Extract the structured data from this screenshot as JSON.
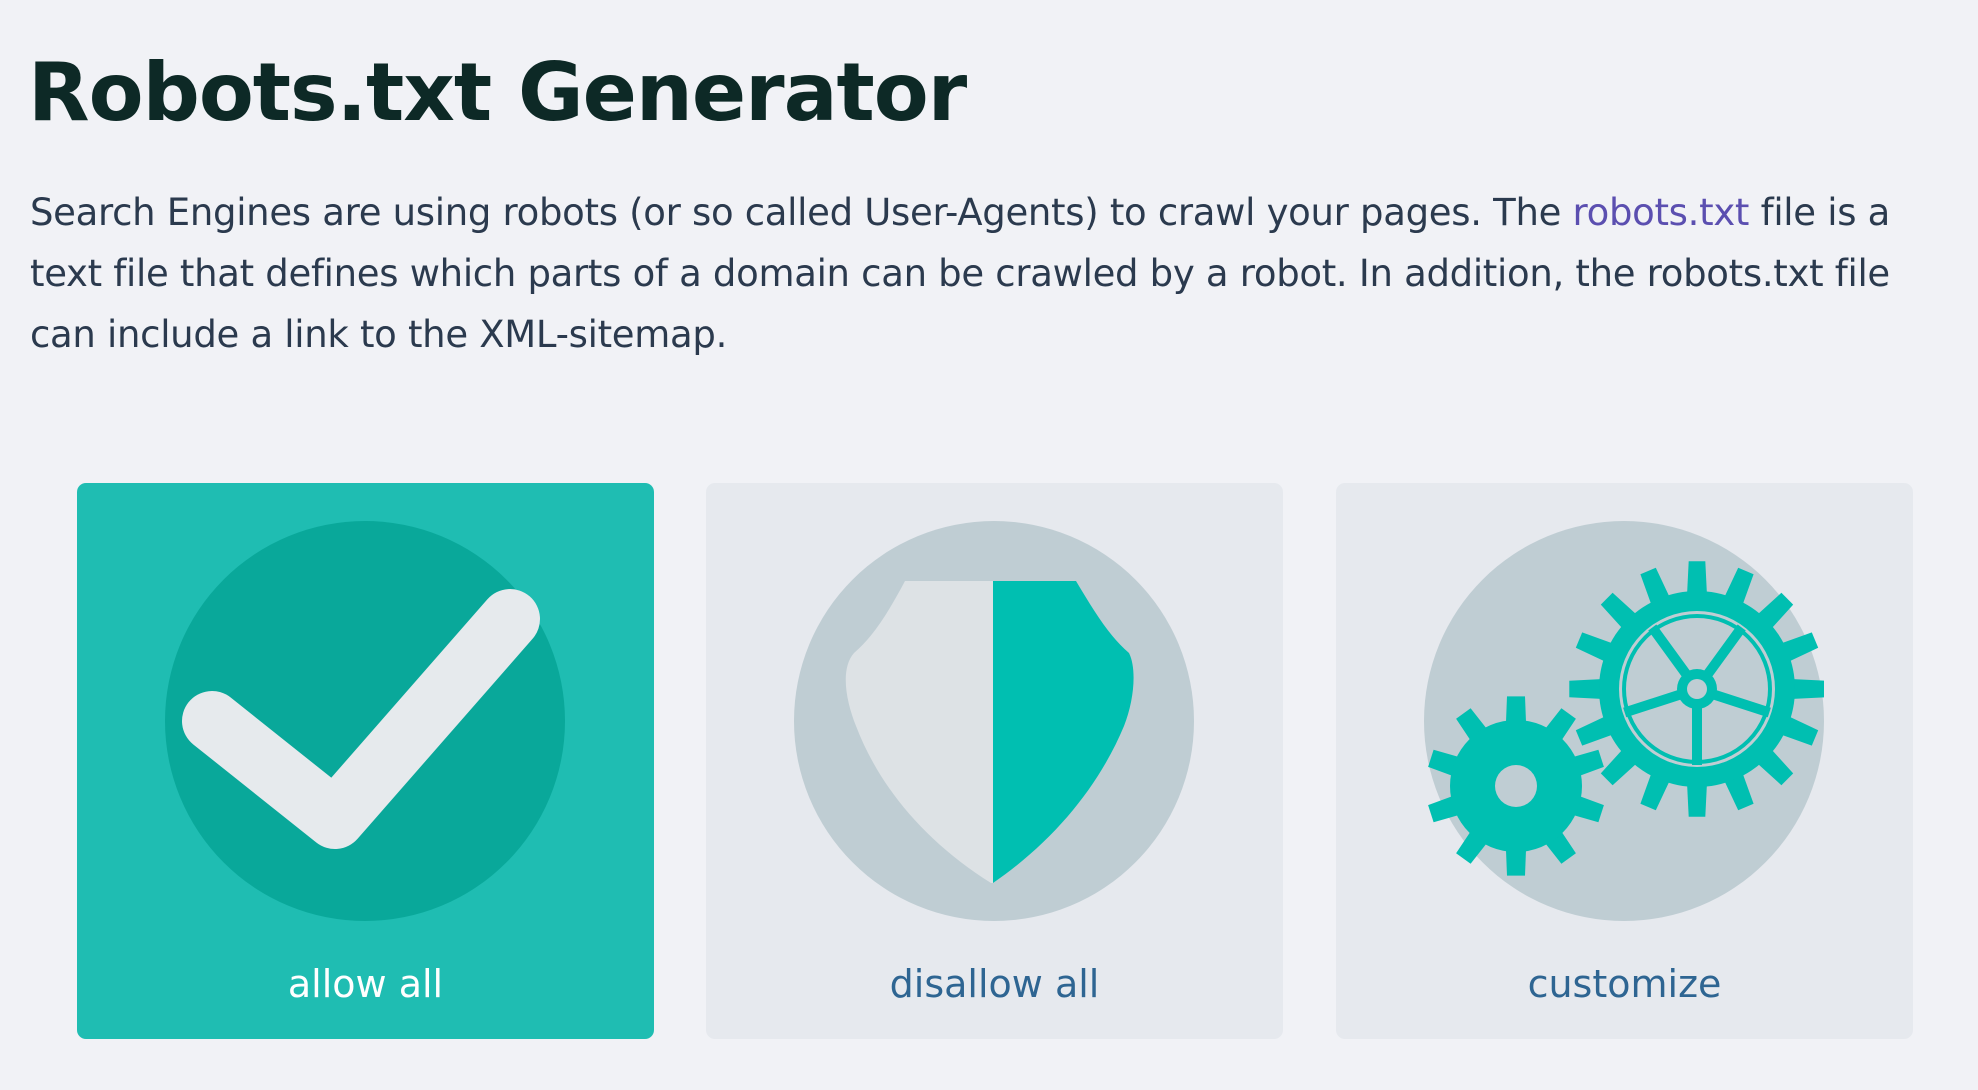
{
  "page": {
    "title": "Robots.txt Generator",
    "intro": {
      "line1_before_link": "Search Engines are using robots (or so called User-Agents) to crawl your pages. The ",
      "link_text": "robots.txt",
      "line1_after_link": " file is a",
      "line2": "text file that defines which parts of a domain can be crawled by a robot. In addition, the robots.txt file",
      "line3": "can include a link to the XML-sitemap."
    }
  },
  "options": [
    {
      "label": "allow all",
      "icon": "checkmark-icon",
      "selected": true
    },
    {
      "label": "disallow all",
      "icon": "shield-icon",
      "selected": false
    },
    {
      "label": "customize",
      "icon": "gears-icon",
      "selected": false
    }
  ],
  "colors": {
    "background": "#f1f2f6",
    "title": "#0d2926",
    "body_text": "#2b3a4e",
    "link": "#5b4fb0",
    "card_default": "#e6e9ee",
    "card_selected": "#1fbdb2",
    "icon_circle_default": "#bfcdd3",
    "icon_circle_selected": "#09a89a",
    "icon_accent": "#00bfb1",
    "icon_light": "#e6eaed",
    "label_default": "#2e6592",
    "label_selected": "#ffffff"
  }
}
